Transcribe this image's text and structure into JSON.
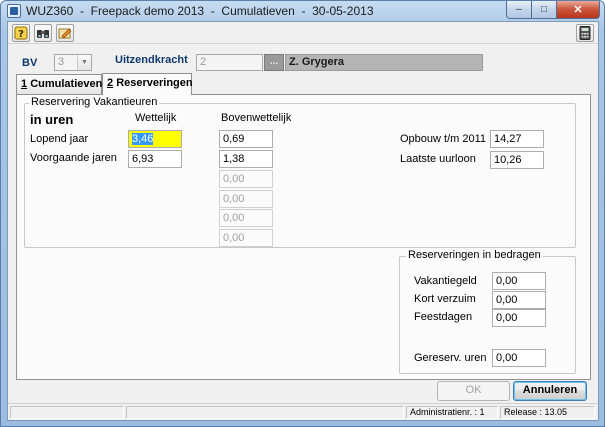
{
  "window": {
    "title": "WUZ360  -  Freepack demo 2013  -  Cumulatieven  -  30-05-2013",
    "buttons": {
      "minimize": "–",
      "maximize": "□",
      "close": "✕"
    }
  },
  "toolbar": {
    "icons": [
      "help-icon",
      "binoculars-icon",
      "edit-icon",
      "calculator-icon"
    ]
  },
  "header": {
    "bv_label": "BV",
    "bv_value": "3",
    "uitzendkracht_label": "Uitzendkracht",
    "uitzendkracht_value": "2",
    "lookup_button": "...",
    "employee_name": "Z. Grygera"
  },
  "tabs": [
    {
      "label": "Cumulatieven",
      "hotkey": "1",
      "active": false
    },
    {
      "label": "Reserveringen",
      "hotkey": "2",
      "active": true
    }
  ],
  "vakantieuren": {
    "group_title": "Reservering Vakantieuren",
    "unit_heading": "in uren",
    "col_wettelijk": "Wettelijk",
    "col_bovenwettelijk": "Bovenwettelijk",
    "row_lopend": "Lopend jaar",
    "row_voorgaande": "Voorgaande jaren",
    "lopend_wettelijk": "3,46",
    "voorgaande_wettelijk": "6,93",
    "bovenwettelijk": [
      "0,69",
      "1,38",
      "0,00",
      "0,00",
      "0,00",
      "0,00"
    ],
    "opbouw_label": "Opbouw t/m 2011",
    "opbouw_value": "14,27",
    "uurloon_label": "Laatste uurloon",
    "uurloon_value": "10,26"
  },
  "bedragen": {
    "group_title": "Reserveringen in bedragen",
    "vakantiegeld_label": "Vakantiegeld",
    "vakantiegeld_value": "0,00",
    "kortverzuim_label": "Kort verzuim",
    "kortverzuim_value": "0,00",
    "feestdagen_label": "Feestdagen",
    "feestdagen_value": "0,00",
    "gereserv_label": "Gereserv. uren",
    "gereserv_value": "0,00"
  },
  "actions": {
    "ok_label": "OK",
    "cancel_label": "Annuleren"
  },
  "statusbar": {
    "administratie": "Administratienr. :   1",
    "release": "Release : 13.05"
  }
}
